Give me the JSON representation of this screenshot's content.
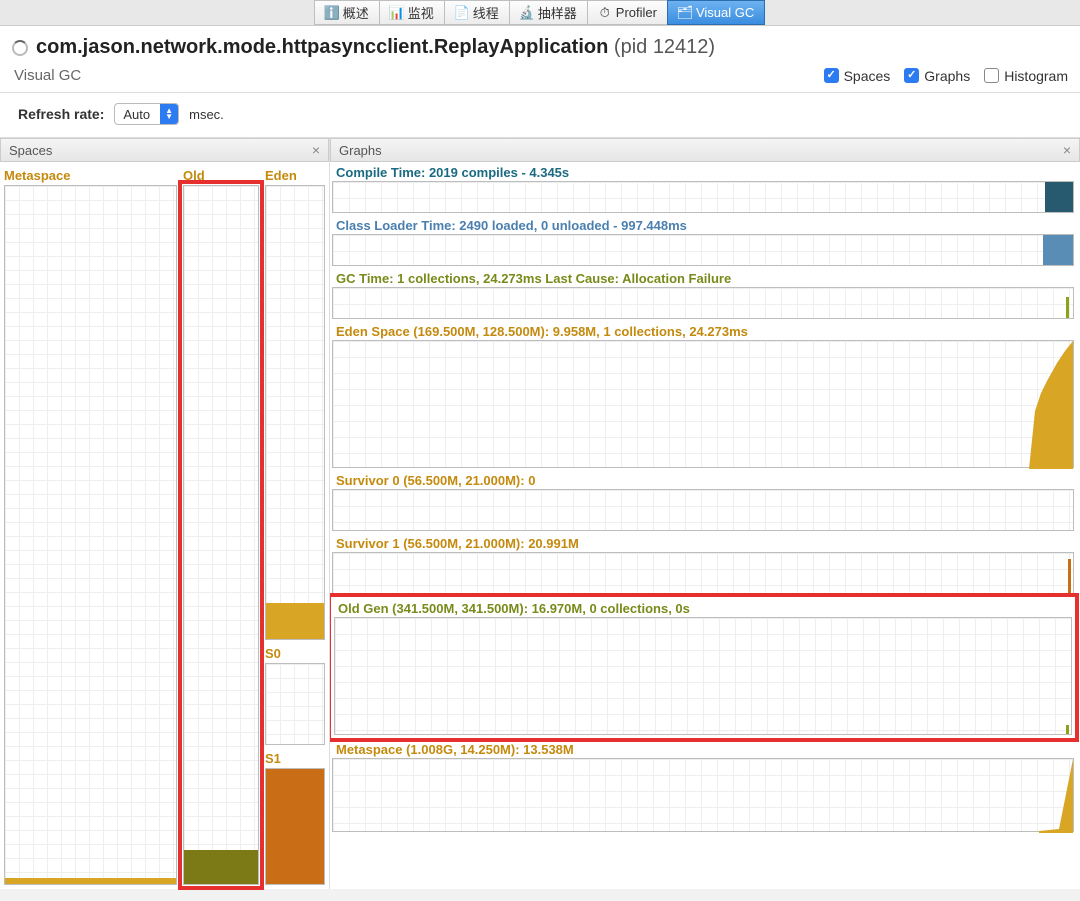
{
  "tabs": {
    "overview": "概述",
    "monitor": "监视",
    "threads": "线程",
    "sampler": "抽样器",
    "profiler": "Profiler",
    "visualgc": "Visual GC"
  },
  "app": {
    "title": "com.jason.network.mode.httpasyncclient.ReplayApplication",
    "pid_label": "(pid 12412)"
  },
  "subhead": {
    "name": "Visual GC",
    "opt_spaces": "Spaces",
    "opt_graphs": "Graphs",
    "opt_histogram": "Histogram"
  },
  "refresh": {
    "label": "Refresh rate:",
    "value": "Auto",
    "unit": "msec."
  },
  "panels": {
    "spaces_title": "Spaces",
    "graphs_title": "Graphs"
  },
  "spaces": {
    "metaspace": "Metaspace",
    "old": "Old",
    "eden": "Eden",
    "s0": "S0",
    "s1": "S1"
  },
  "graphs": {
    "compile": "Compile Time: 2019 compiles - 4.345s",
    "classloader": "Class Loader Time: 2490 loaded, 0 unloaded - 997.448ms",
    "gctime": "GC Time: 1 collections, 24.273ms Last Cause: Allocation Failure",
    "eden": "Eden Space (169.500M, 128.500M): 9.958M, 1 collections, 24.273ms",
    "s0": "Survivor 0 (56.500M, 21.000M): 0",
    "s1": "Survivor 1 (56.500M, 21.000M): 20.991M",
    "oldgen": "Old Gen (341.500M, 341.500M): 16.970M, 0 collections, 0s",
    "metaspace": "Metaspace (1.008G, 14.250M): 13.538M"
  },
  "chart_data": [
    {
      "type": "bar",
      "name": "Metaspace-space",
      "capacity": "1.008G",
      "used_pct_est": 2
    },
    {
      "type": "bar",
      "name": "Old-space",
      "capacity": "341.500M",
      "used_pct_est": 5
    },
    {
      "type": "bar",
      "name": "Eden-space",
      "capacity": "128.500M",
      "used_pct_est": 8
    },
    {
      "type": "bar",
      "name": "S0-space",
      "capacity": "21.000M",
      "used_pct_est": 0
    },
    {
      "type": "bar",
      "name": "S1-space",
      "capacity": "21.000M",
      "used_pct_est": 100
    },
    {
      "type": "area",
      "name": "Compile Time",
      "title": "2019 compiles - 4.345s"
    },
    {
      "type": "area",
      "name": "Class Loader Time",
      "title": "2490 loaded, 0 unloaded - 997.448ms"
    },
    {
      "type": "area",
      "name": "GC Time",
      "title": "1 collections, 24.273ms",
      "annotation": "Allocation Failure"
    },
    {
      "type": "area",
      "name": "Eden Space",
      "capacity": "169.500M",
      "committed": "128.500M",
      "used": "9.958M",
      "collections": 1,
      "time_ms": 24.273
    },
    {
      "type": "area",
      "name": "Survivor 0",
      "capacity": "56.500M",
      "committed": "21.000M",
      "used": "0"
    },
    {
      "type": "area",
      "name": "Survivor 1",
      "capacity": "56.500M",
      "committed": "21.000M",
      "used": "20.991M"
    },
    {
      "type": "area",
      "name": "Old Gen",
      "capacity": "341.500M",
      "committed": "341.500M",
      "used": "16.970M",
      "collections": 0,
      "time_s": 0
    },
    {
      "type": "area",
      "name": "Metaspace",
      "capacity": "1.008G",
      "committed": "14.250M",
      "used": "13.538M"
    }
  ]
}
